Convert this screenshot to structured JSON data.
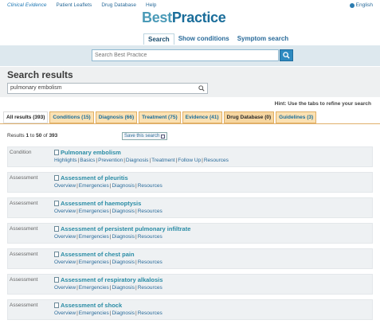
{
  "topnav": [
    "Clinical Evidence",
    "Patient Leaflets",
    "Drug Database",
    "Help"
  ],
  "lang": "English",
  "logo": {
    "part1": "Best",
    "part2": "Practice"
  },
  "tabs": [
    "Search",
    "Show conditions",
    "Symptom search"
  ],
  "search": {
    "placeholder": "Search Best Practice"
  },
  "results_header": {
    "title": "Search results",
    "query": "pulmonary embolism"
  },
  "hint": "Hint: Use the tabs to refine your search",
  "result_tabs": [
    "All results (393)",
    "Conditions (15)",
    "Diagnosis (66)",
    "Treatment (75)",
    "Evidence (41)",
    "Drug Database (0)",
    "Guidelines (3)"
  ],
  "count": {
    "prefix": "Results ",
    "from": "1",
    "to_word": " to ",
    "to": "50",
    "of": " of ",
    "total": "393"
  },
  "save_search": "Save this search",
  "results": [
    {
      "type": "Condition",
      "title": "Pulmonary embolism",
      "links": [
        "Highlights",
        "Basics",
        "Prevention",
        "Diagnosis",
        "Treatment",
        "Follow Up",
        "Resources"
      ]
    },
    {
      "type": "Assessment",
      "title": "Assessment of pleuritis",
      "links": [
        "Overview",
        "Emergencies",
        "Diagnosis",
        "Resources"
      ]
    },
    {
      "type": "Assessment",
      "title": "Assessment of haemoptysis",
      "links": [
        "Overview",
        "Emergencies",
        "Diagnosis",
        "Resources"
      ]
    },
    {
      "type": "Assessment",
      "title": "Assessment of persistent pulmonary infiltrate",
      "links": [
        "Overview",
        "Emergencies",
        "Diagnosis",
        "Resources"
      ]
    },
    {
      "type": "Assessment",
      "title": "Assessment of chest pain",
      "links": [
        "Overview",
        "Emergencies",
        "Diagnosis",
        "Resources"
      ]
    },
    {
      "type": "Assessment",
      "title": "Assessment of respiratory alkalosis",
      "links": [
        "Overview",
        "Emergencies",
        "Diagnosis",
        "Resources"
      ]
    },
    {
      "type": "Assessment",
      "title": "Assessment of shock",
      "links": [
        "Overview",
        "Emergencies",
        "Diagnosis",
        "Resources"
      ]
    }
  ]
}
